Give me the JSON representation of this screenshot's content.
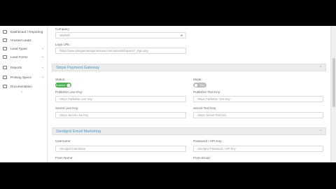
{
  "sidebar": {
    "items": [
      {
        "label": "Dashboard / Reporting",
        "icon": "chart-icon",
        "has_chevron": false
      },
      {
        "label": "Unused Leads",
        "icon": "list-icon",
        "has_chevron": false
      },
      {
        "label": "Lead Types",
        "icon": "tag-icon",
        "has_chevron": true
      },
      {
        "label": "Lead Forms",
        "icon": "form-icon",
        "has_chevron": true
      },
      {
        "label": "Reports",
        "icon": "report-icon",
        "has_chevron": true
      },
      {
        "label": "Printing Specs",
        "icon": "printer-icon",
        "has_chevron": true
      },
      {
        "label": "Documentation",
        "icon": "book-icon",
        "has_chevron": false
      }
    ],
    "chevron": "⌄",
    "collapse": "‹"
  },
  "company": {
    "company_label": "Company:",
    "company_value": "WWWB",
    "logo_label": "Logo URL:",
    "logo_value": "https://www.pledgemanagementusa.com/uploads/logos/47_logo.png"
  },
  "stripe": {
    "title": "Stripe Payment Gateway",
    "status_label": "Status:",
    "status_toggle": "Enabled",
    "mode_label": "Mode:",
    "mode_toggle": "Test",
    "pub_live_label": "Publisher Live Key:",
    "pub_live_placeholder": "Stripe Publisher Live Key",
    "pub_test_label": "Publisher Test Key:",
    "pub_test_placeholder": "Stripe Publisher Test Key",
    "secret_live_label": "Secret Live Key:",
    "secret_live_placeholder": "Stripe Secret Live Key",
    "secret_test_label": "Secret Test Key:",
    "secret_test_placeholder": "Stripe Secret Test Key"
  },
  "sendgrid": {
    "title": "Sendgrid Email Marketing",
    "username_label": "Username:",
    "username_placeholder": "Sendgrid Username",
    "password_label": "Password / API Key:",
    "password_placeholder": "Sendgrid Password / API Key",
    "from_name_label": "From Name:",
    "from_email_label": "From Email:"
  },
  "colors": {
    "accent": "#4a9bc9",
    "toggle_on": "#4caf50",
    "toggle_test": "#bdbdbd"
  }
}
